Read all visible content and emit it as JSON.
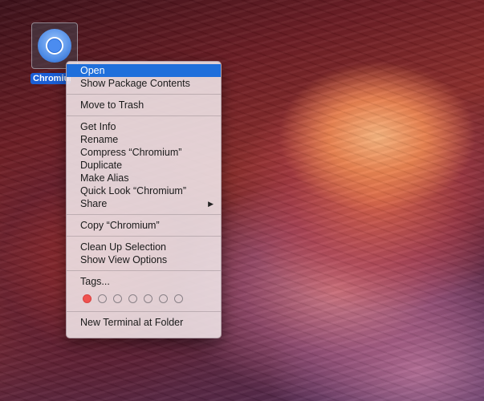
{
  "desktop_icon": {
    "label": "Chromium",
    "icon": "chromium-app-icon"
  },
  "context_menu": {
    "groups": [
      {
        "items": [
          {
            "label": "Open",
            "highlighted": true
          },
          {
            "label": "Show Package Contents"
          }
        ]
      },
      {
        "items": [
          {
            "label": "Move to Trash"
          }
        ]
      },
      {
        "items": [
          {
            "label": "Get Info"
          },
          {
            "label": "Rename"
          },
          {
            "label": "Compress “Chromium”"
          },
          {
            "label": "Duplicate"
          },
          {
            "label": "Make Alias"
          },
          {
            "label": "Quick Look “Chromium”"
          },
          {
            "label": "Share",
            "submenu": true
          }
        ]
      },
      {
        "items": [
          {
            "label": "Copy “Chromium”"
          }
        ]
      },
      {
        "items": [
          {
            "label": "Clean Up Selection"
          },
          {
            "label": "Show View Options"
          }
        ]
      },
      {
        "items": [
          {
            "label": "Tags..."
          }
        ]
      },
      {
        "items": [
          {
            "label": "New Terminal at Folder"
          }
        ]
      }
    ],
    "tag_colors": [
      "#f0524f",
      "none",
      "none",
      "none",
      "none",
      "none",
      "none"
    ],
    "highlight_color": "#1f6fdb"
  }
}
